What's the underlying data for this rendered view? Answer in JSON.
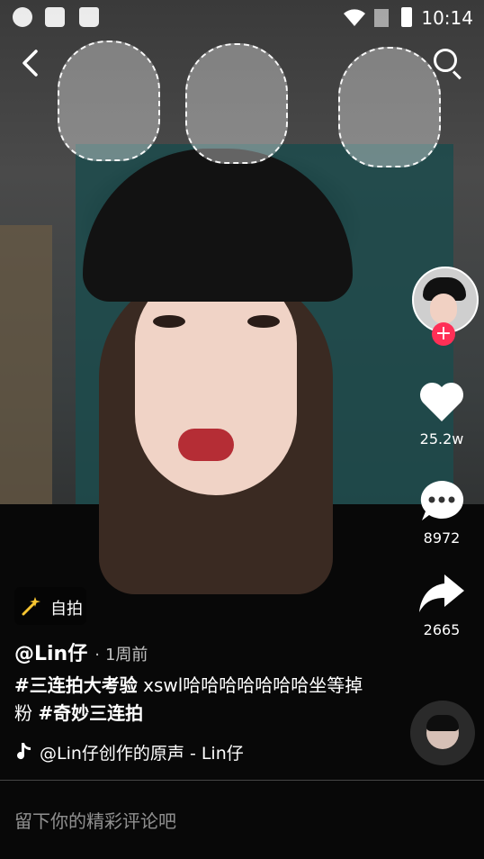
{
  "status_bar": {
    "time": "10:14",
    "left_icons": [
      "wechat-icon",
      "app-icon",
      "bag-icon"
    ],
    "right_icons": [
      "wifi-icon",
      "sim-icon",
      "battery-icon"
    ]
  },
  "nav": {
    "back_icon": "chevron-left-icon",
    "search_icon": "search-icon"
  },
  "effect_chip": {
    "label": "自拍",
    "icon": "magic-wand-icon"
  },
  "author": {
    "handle": "@Lin仔",
    "separator": "·",
    "posted_ago": "1周前"
  },
  "description": {
    "tag1": "#三连拍大考验",
    "text": " xswl哈哈哈哈哈哈哈坐等掉粉 ",
    "tag2": "#奇妙三连拍"
  },
  "music": {
    "icon": "music-note-icon",
    "text": "@Lin仔创作的原声 - Lin仔"
  },
  "actions": {
    "likes": "25.2w",
    "comments": "8972",
    "shares": "2665",
    "follow_symbol": "+"
  },
  "comment_input": {
    "placeholder": "留下你的精彩评论吧"
  },
  "colors": {
    "follow_red": "#ff2f56",
    "white": "#ffffff"
  }
}
